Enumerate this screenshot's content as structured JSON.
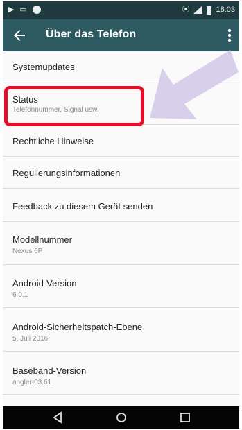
{
  "status_bar": {
    "time": "18:03",
    "left_icons": [
      "play-icon",
      "screen-icon",
      "notification-icon"
    ],
    "right_icons": [
      "vibrate-icon",
      "signal-icon",
      "battery-icon"
    ]
  },
  "app_bar": {
    "title": "Über das Telefon",
    "back_icon": "arrow-back-icon",
    "menu_icon": "more-vert-icon"
  },
  "items": [
    {
      "title": "Systemupdates"
    },
    {
      "title": "Status",
      "subtitle": "Telefonnummer, Signal usw."
    },
    {
      "title": "Rechtliche Hinweise"
    },
    {
      "title": "Regulierungsinformationen"
    },
    {
      "title": "Feedback zu diesem Gerät senden"
    },
    {
      "title": "Modellnummer",
      "subtitle": "Nexus 6P"
    },
    {
      "title": "Android-Version",
      "subtitle": "6.0.1"
    },
    {
      "title": "Android-Sicherheitspatch-Ebene",
      "subtitle": "5. Juli 2016"
    },
    {
      "title": "Baseband-Version",
      "subtitle": "angler-03.61"
    }
  ],
  "nav_bar": {
    "icons": [
      "back-triangle-icon",
      "home-circle-icon",
      "recents-square-icon"
    ]
  },
  "colors": {
    "status_bar": "#1f3a3e",
    "app_bar": "#2e5b61",
    "highlight": "#e0102a",
    "arrow": "#d4cbe8"
  }
}
